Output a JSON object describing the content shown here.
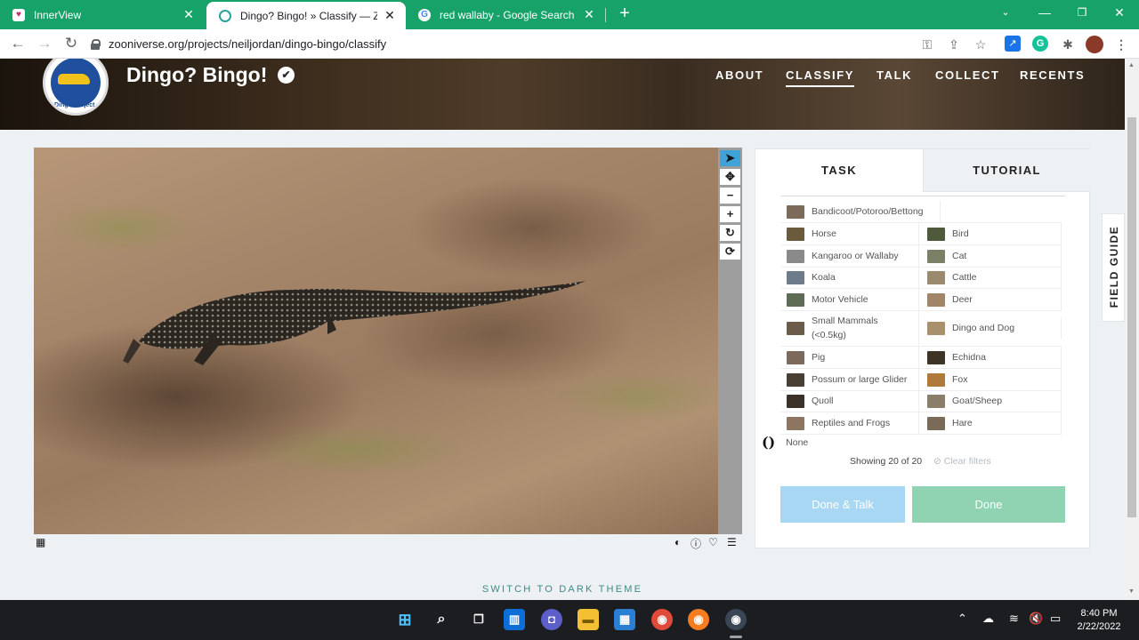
{
  "browser": {
    "tabs": [
      {
        "title": "InnerView",
        "active": false
      },
      {
        "title": "Dingo? Bingo! » Classify — Zooniverse",
        "active": true
      },
      {
        "title": "red wallaby - Google Search",
        "active": false
      }
    ],
    "new_tab": "+",
    "address": "zooniverse.org/projects/neiljordan/dingo-bingo/classify"
  },
  "header": {
    "logo_text": "Dingo Project",
    "title": "Dingo? Bingo!",
    "verified": "✔",
    "nav": [
      "ABOUT",
      "CLASSIFY",
      "TALK",
      "COLLECT",
      "RECENTS"
    ]
  },
  "viewer": {
    "tools": [
      "pointer-icon",
      "move-icon",
      "zoom-out-icon",
      "zoom-in-icon",
      "rotate-icon",
      "reset-icon"
    ]
  },
  "task_panel": {
    "tabs": {
      "task": "TASK",
      "tutorial": "TUTORIAL"
    },
    "choices": [
      {
        "label": "Bandicoot/Potoroo/Bettong",
        "color": "#7d6b5a"
      },
      {
        "label": "Horse",
        "color": "#6b5a3c"
      },
      {
        "label": "Bird",
        "color": "#4e5a3a"
      },
      {
        "label": "Kangaroo or Wallaby",
        "color": "#8a8a8a"
      },
      {
        "label": "Cat",
        "color": "#7a8066"
      },
      {
        "label": "Koala",
        "color": "#6d7b8a"
      },
      {
        "label": "Cattle",
        "color": "#9a8a6e"
      },
      {
        "label": "Motor Vehicle",
        "color": "#5e6b55"
      },
      {
        "label": "Deer",
        "color": "#a08566"
      },
      {
        "label": "Small Mammals (<0.5kg)",
        "color": "#6b5c4a"
      },
      {
        "label": "Dingo and Dog",
        "color": "#a8906c"
      },
      {
        "label": "Pig",
        "color": "#7b6a5c"
      },
      {
        "label": "Echidna",
        "color": "#3e3426"
      },
      {
        "label": "Possum or large Glider",
        "color": "#4a3f35"
      },
      {
        "label": "Fox",
        "color": "#b07a3a"
      },
      {
        "label": "Quoll",
        "color": "#3a3128"
      },
      {
        "label": "Goat/Sheep",
        "color": "#8a7d6a"
      },
      {
        "label": "Reptiles and Frogs",
        "color": "#8c7662"
      },
      {
        "label": "Hare",
        "color": "#7a6a58"
      }
    ],
    "none_label": "None",
    "showing": "Showing 20 of 20",
    "clear_filters": "⊘ Clear filters",
    "done_talk": "Done & Talk",
    "done": "Done"
  },
  "field_guide": "FIELD GUIDE",
  "footer": {
    "dark_theme": "SWITCH TO DARK THEME"
  },
  "taskbar": {
    "time": "8:40 PM",
    "date": "2/22/2022"
  }
}
